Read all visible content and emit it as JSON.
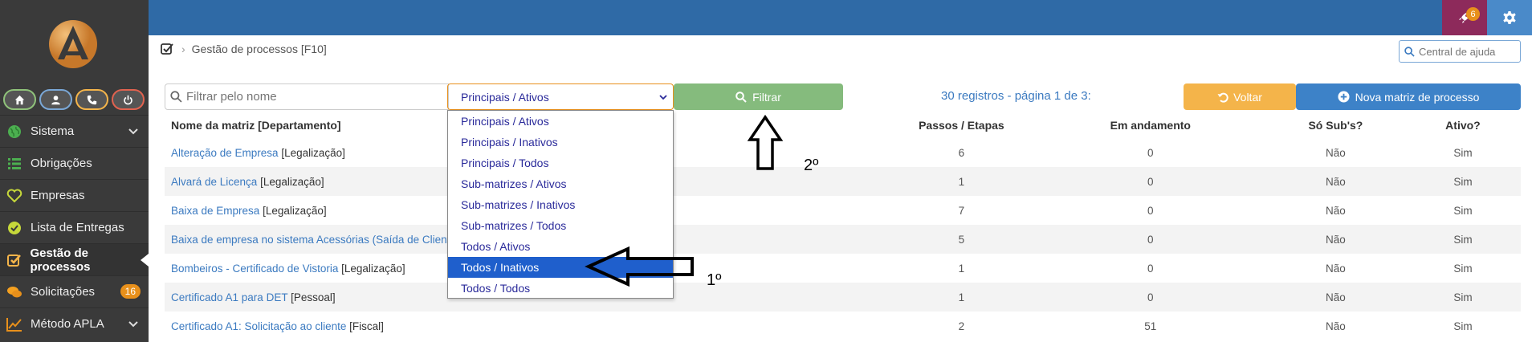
{
  "sidebar": {
    "quick_buttons": [
      {
        "icon": "home-icon",
        "border": "#8fc27a"
      },
      {
        "icon": "user-icon",
        "border": "#7aa7d6"
      },
      {
        "icon": "phone-icon",
        "border": "#f4b44a"
      },
      {
        "icon": "power-icon",
        "border": "#e0624f"
      }
    ],
    "items": [
      {
        "label": "Sistema",
        "icon": "globe-icon",
        "has_chevron": true
      },
      {
        "label": "Obrigações",
        "icon": "list-icon"
      },
      {
        "label": "Empresas",
        "icon": "heart-icon"
      },
      {
        "label": "Lista de Entregas",
        "icon": "check-circle-icon"
      },
      {
        "label": "Gestão de processos",
        "icon": "checkbox-icon",
        "active": true
      },
      {
        "label": "Solicitações",
        "icon": "chat-icon",
        "badge": "16"
      },
      {
        "label": "Método APLA",
        "icon": "chart-icon",
        "has_chevron": true
      }
    ]
  },
  "topbar": {
    "rocket_badge": "6",
    "colors": {
      "bar": "#2f6aa6",
      "rocket": "#8d2a5b",
      "gear": "#4a8ac9"
    }
  },
  "breadcrumb": {
    "title": "Gestão de processos [F10]"
  },
  "help": {
    "placeholder": "Central de ajuda"
  },
  "filters": {
    "name_placeholder": "Filtrar pelo nome",
    "select_value": "Principais / Ativos",
    "filter_button": "Filtrar",
    "records_text": "30 registros - página 1 de 3:",
    "back_button": "Voltar",
    "new_button": "Nova matriz de processo"
  },
  "dropdown": {
    "options": [
      "Principais / Ativos",
      "Principais / Inativos",
      "Principais / Todos",
      "Sub-matrizes / Ativos",
      "Sub-matrizes / Inativos",
      "Sub-matrizes / Todos",
      "Todos / Ativos",
      "Todos / Inativos",
      "Todos / Todos"
    ],
    "highlighted": "Todos / Inativos"
  },
  "table": {
    "headers": {
      "name": "Nome da matriz [Departamento]",
      "steps": "Passos / Etapas",
      "progress": "Em andamento",
      "sub": "Só Sub's?",
      "active": "Ativo?"
    },
    "rows": [
      {
        "name": "Alteração de Empresa",
        "dept": "[Legalização]",
        "steps": "6",
        "progress": "0",
        "sub": "Não",
        "active": "Sim"
      },
      {
        "name": "Alvará de Licença",
        "dept": "[Legalização]",
        "steps": "1",
        "progress": "0",
        "sub": "Não",
        "active": "Sim"
      },
      {
        "name": "Baixa de Empresa",
        "dept": "[Legalização]",
        "steps": "7",
        "progress": "0",
        "sub": "Não",
        "active": "Sim"
      },
      {
        "name": "Baixa de empresa no sistema Acessórias (Saída de Cliente",
        "dept": "",
        "steps": "5",
        "progress": "0",
        "sub": "Não",
        "active": "Sim"
      },
      {
        "name": "Bombeiros - Certificado de Vistoria",
        "dept": "[Legalização]",
        "steps": "1",
        "progress": "0",
        "sub": "Não",
        "active": "Sim"
      },
      {
        "name": "Certificado A1 para DET",
        "dept": "[Pessoal]",
        "steps": "1",
        "progress": "0",
        "sub": "Não",
        "active": "Sim"
      },
      {
        "name": "Certificado A1: Solicitação ao cliente",
        "dept": "[Fiscal]",
        "steps": "2",
        "progress": "51",
        "sub": "Não",
        "active": "Sim"
      }
    ]
  },
  "annotations": {
    "first": "1º",
    "second": "2º"
  }
}
